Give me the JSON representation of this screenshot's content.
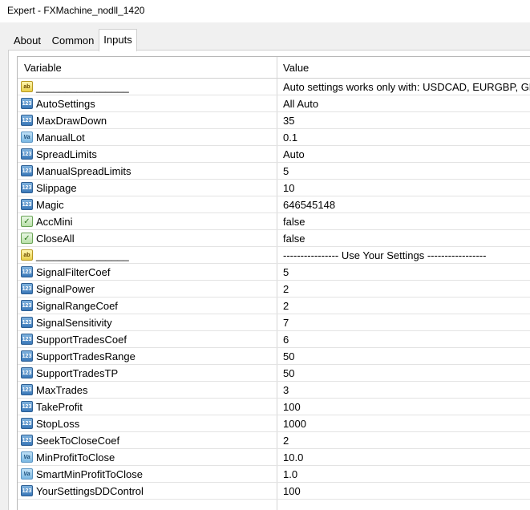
{
  "window": {
    "title": "Expert - FXMachine_nodll_1420"
  },
  "tabs": {
    "about": "About",
    "common": "Common",
    "inputs": "Inputs"
  },
  "grid": {
    "col_variable": "Variable",
    "col_value": "Value",
    "rows": [
      {
        "type": "str",
        "icon_label": "ab",
        "name": "________________",
        "value": "Auto settings works only with: USDCAD, EURGBP, GB."
      },
      {
        "type": "int",
        "icon_label": "123",
        "name": "AutoSettings",
        "value": "All Auto"
      },
      {
        "type": "int",
        "icon_label": "123",
        "name": "MaxDrawDown",
        "value": "35"
      },
      {
        "type": "dbl",
        "icon_label": "Va",
        "name": "ManualLot",
        "value": "0.1"
      },
      {
        "type": "int",
        "icon_label": "123",
        "name": "SpreadLimits",
        "value": "Auto"
      },
      {
        "type": "int",
        "icon_label": "123",
        "name": "ManualSpreadLimits",
        "value": "5"
      },
      {
        "type": "int",
        "icon_label": "123",
        "name": "Slippage",
        "value": "10"
      },
      {
        "type": "int",
        "icon_label": "123",
        "name": "Magic",
        "value": "646545148"
      },
      {
        "type": "bool",
        "icon_label": "✓",
        "name": "AccMini",
        "value": "false"
      },
      {
        "type": "bool",
        "icon_label": "✓",
        "name": "CloseAll",
        "value": "false"
      },
      {
        "type": "str",
        "icon_label": "ab",
        "name": "________________",
        "value": "----------------  Use Your Settings -----------------"
      },
      {
        "type": "int",
        "icon_label": "123",
        "name": "SignalFilterCoef",
        "value": "5"
      },
      {
        "type": "int",
        "icon_label": "123",
        "name": "SignalPower",
        "value": "2"
      },
      {
        "type": "int",
        "icon_label": "123",
        "name": "SignalRangeCoef",
        "value": "2"
      },
      {
        "type": "int",
        "icon_label": "123",
        "name": "SignalSensitivity",
        "value": "7"
      },
      {
        "type": "int",
        "icon_label": "123",
        "name": "SupportTradesCoef",
        "value": "6"
      },
      {
        "type": "int",
        "icon_label": "123",
        "name": "SupportTradesRange",
        "value": "50"
      },
      {
        "type": "int",
        "icon_label": "123",
        "name": "SupportTradesTP",
        "value": "50"
      },
      {
        "type": "int",
        "icon_label": "123",
        "name": "MaxTrades",
        "value": "3"
      },
      {
        "type": "int",
        "icon_label": "123",
        "name": "TakeProfit",
        "value": "100"
      },
      {
        "type": "int",
        "icon_label": "123",
        "name": "StopLoss",
        "value": "1000"
      },
      {
        "type": "int",
        "icon_label": "123",
        "name": "SeekToCloseCoef",
        "value": "2"
      },
      {
        "type": "dbl",
        "icon_label": "Va",
        "name": "MinProfitToClose",
        "value": "10.0"
      },
      {
        "type": "dbl",
        "icon_label": "Va",
        "name": "SmartMinProfitToClose",
        "value": "1.0"
      },
      {
        "type": "int",
        "icon_label": "123",
        "name": "YourSettingsDDControl",
        "value": "100"
      }
    ]
  }
}
